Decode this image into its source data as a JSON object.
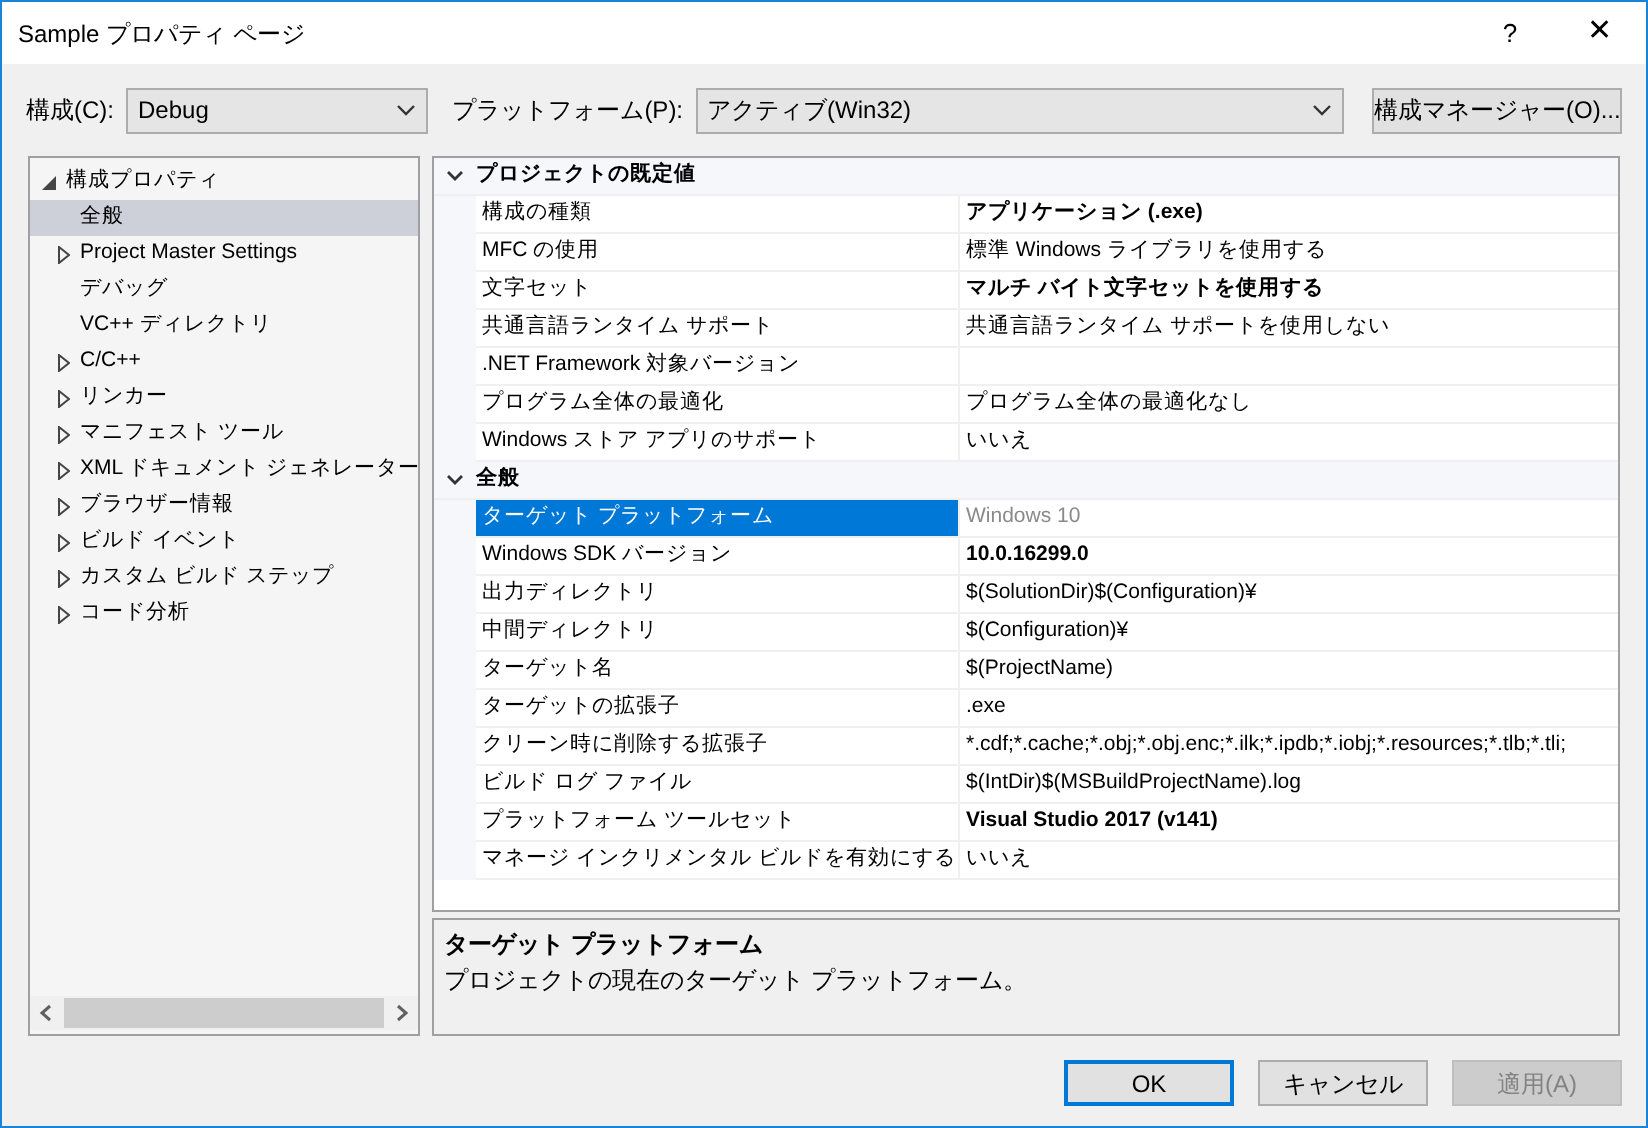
{
  "window": {
    "title": "Sample プロパティ ページ",
    "help": "?",
    "close": "✕"
  },
  "toolbar": {
    "configuration_label": "構成(C):",
    "configuration_value": "Debug",
    "platform_label": "プラットフォーム(P):",
    "platform_value": "アクティブ(Win32)",
    "manager_button": "構成マネージャー(O)..."
  },
  "tree": [
    {
      "label": "構成プロパティ",
      "expanded": true,
      "selected": false,
      "children": [
        {
          "label": "全般",
          "expandable": false,
          "selected": true
        },
        {
          "label": "Project Master Settings",
          "expandable": true,
          "selected": false
        },
        {
          "label": "デバッグ",
          "expandable": false,
          "selected": false
        },
        {
          "label": "VC++ ディレクトリ",
          "expandable": false,
          "selected": false
        },
        {
          "label": "C/C++",
          "expandable": true,
          "selected": false
        },
        {
          "label": "リンカー",
          "expandable": true,
          "selected": false
        },
        {
          "label": "マニフェスト ツール",
          "expandable": true,
          "selected": false
        },
        {
          "label": "XML ドキュメント ジェネレーター",
          "expandable": true,
          "selected": false
        },
        {
          "label": "ブラウザー情報",
          "expandable": true,
          "selected": false
        },
        {
          "label": "ビルド イベント",
          "expandable": true,
          "selected": false
        },
        {
          "label": "カスタム ビルド ステップ",
          "expandable": true,
          "selected": false
        },
        {
          "label": "コード分析",
          "expandable": true,
          "selected": false
        }
      ]
    }
  ],
  "grid": [
    {
      "section": "プロジェクトの既定値",
      "expanded": true,
      "rows": [
        {
          "name": "構成の種類",
          "value": "アプリケーション (.exe)",
          "bold": true,
          "disabled": false,
          "selected": false
        },
        {
          "name": "MFC の使用",
          "value": "標準 Windows ライブラリを使用する",
          "bold": false,
          "disabled": false,
          "selected": false
        },
        {
          "name": "文字セット",
          "value": "マルチ バイト文字セットを使用する",
          "bold": true,
          "disabled": false,
          "selected": false
        },
        {
          "name": "共通言語ランタイム サポート",
          "value": "共通言語ランタイム サポートを使用しない",
          "bold": false,
          "disabled": false,
          "selected": false
        },
        {
          "name": ".NET Framework 対象バージョン",
          "selected": false
        },
        {
          "name": "プログラム全体の最適化",
          "value": "プログラム全体の最適化なし",
          "bold": false,
          "disabled": false,
          "selected": false
        },
        {
          "name": "Windows ストア アプリのサポート",
          "value": "いいえ",
          "bold": false,
          "disabled": false,
          "selected": false
        }
      ]
    },
    {
      "section": "全般",
      "expanded": true,
      "rows": [
        {
          "name": "ターゲット プラットフォーム",
          "value": "Windows 10",
          "bold": false,
          "disabled": true,
          "selected": true
        },
        {
          "name": "Windows SDK バージョン",
          "value": "10.0.16299.0",
          "bold": true,
          "disabled": false,
          "selected": false
        },
        {
          "name": "出力ディレクトリ",
          "value": "$(SolutionDir)$(Configuration)¥",
          "bold": false,
          "disabled": false,
          "selected": false
        },
        {
          "name": "中間ディレクトリ",
          "value": "$(Configuration)¥",
          "bold": false,
          "disabled": false,
          "selected": false
        },
        {
          "name": "ターゲット名",
          "value": "$(ProjectName)",
          "bold": false,
          "disabled": false,
          "selected": false
        },
        {
          "name": "ターゲットの拡張子",
          "value": ".exe",
          "bold": false,
          "disabled": false,
          "selected": false
        },
        {
          "name": "クリーン時に削除する拡張子",
          "value": "*.cdf;*.cache;*.obj;*.obj.enc;*.ilk;*.ipdb;*.iobj;*.resources;*.tlb;*.tli;",
          "bold": false,
          "disabled": false,
          "selected": false
        },
        {
          "name": "ビルド ログ ファイル",
          "value": "$(IntDir)$(MSBuildProjectName).log",
          "bold": false,
          "disabled": false,
          "selected": false
        },
        {
          "name": "プラットフォーム ツールセット",
          "value": "Visual Studio 2017 (v141)",
          "bold": true,
          "disabled": false,
          "selected": false
        },
        {
          "name": "マネージ インクリメンタル ビルドを有効にする",
          "value": "いいえ",
          "bold": false,
          "disabled": false,
          "selected": false
        }
      ]
    }
  ],
  "description": {
    "title": "ターゲット プラットフォーム",
    "text": "プロジェクトの現在のターゲット プラットフォーム。"
  },
  "buttons": [
    {
      "label": "OK",
      "default": true,
      "disabled": false
    },
    {
      "label": "キャンセル",
      "default": false,
      "disabled": false
    },
    {
      "label": "適用(A)",
      "default": false,
      "disabled": true
    }
  ]
}
